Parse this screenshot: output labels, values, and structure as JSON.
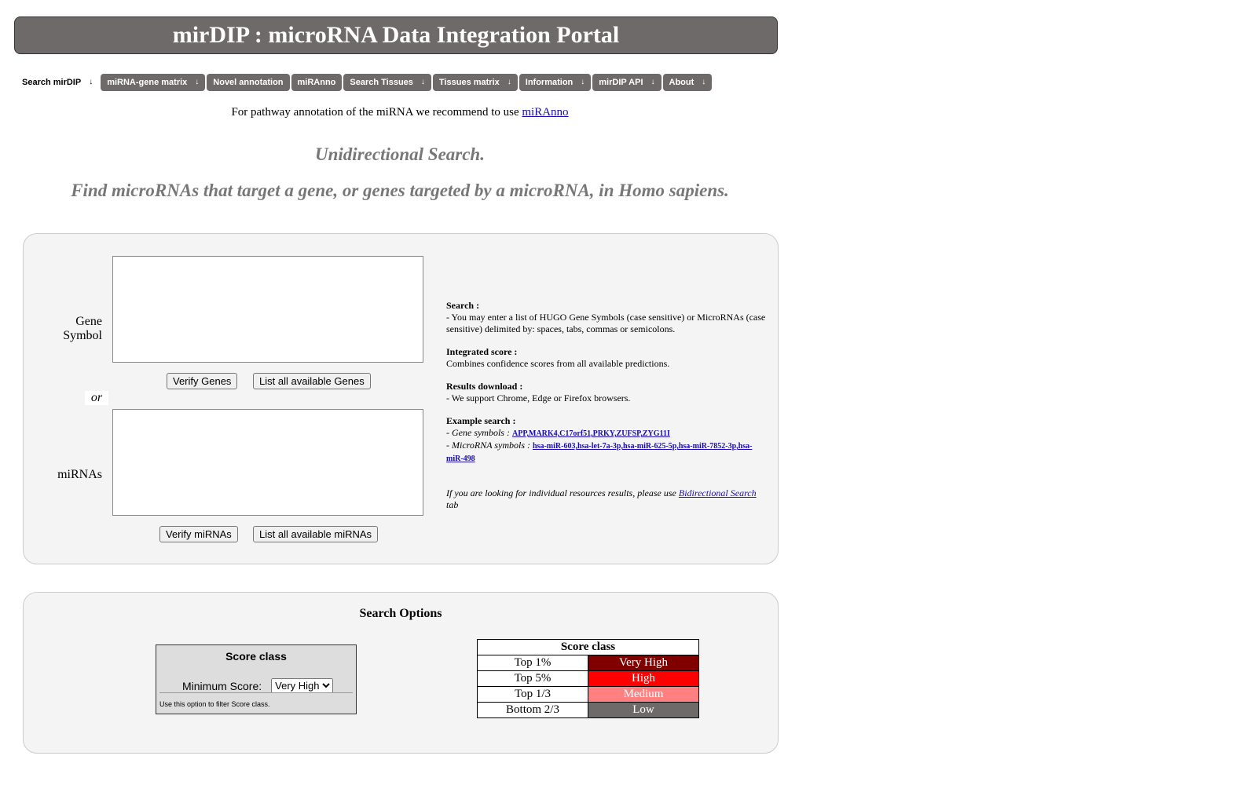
{
  "header": {
    "title": "mirDIP : microRNA Data Integration Portal"
  },
  "nav": {
    "items": [
      {
        "label": "Search mirDIP",
        "arrow": "↓"
      },
      {
        "label": "miRNA-gene matrix",
        "arrow": "↓"
      },
      {
        "label": "Novel annotation",
        "arrow": ""
      },
      {
        "label": "miRAnno",
        "arrow": ""
      },
      {
        "label": "Search Tissues",
        "arrow": "↓"
      },
      {
        "label": "Tissues matrix",
        "arrow": "↓"
      },
      {
        "label": "Information",
        "arrow": "↓"
      },
      {
        "label": "mirDIP API",
        "arrow": "↓"
      },
      {
        "label": "About",
        "arrow": "↓"
      }
    ]
  },
  "recommend": {
    "text": "For pathway annotation of the miRNA we recommend to use",
    "link": "miRAnno"
  },
  "titles": {
    "line1": "Unidirectional Search.",
    "line2": "Find microRNAs that target a gene, or genes targeted by a microRNA, in Homo sapiens."
  },
  "search": {
    "gene_label": "Gene Symbol",
    "mirna_label": "miRNAs",
    "or_label": "or",
    "verify_genes": "Verify Genes",
    "list_genes": "List all available Genes",
    "verify_mirnas": "Verify miRNAs",
    "list_mirnas": "List all available miRNAs",
    "gene_value": "",
    "mirna_value": ""
  },
  "help": {
    "search_title": "Search :",
    "search_text": "- You may enter a list of HUGO Gene Symbols (case sensitive) or MicroRNAs (case sensitive) delimited by: spaces, tabs, commas or semicolons.",
    "integrated_title": "Integrated score :",
    "integrated_text": "Combines confidence scores from all available predictions.",
    "download_title": "Results download :",
    "download_text": "- We support Chrome, Edge or Firefox browsers.",
    "example_title": "Example search :",
    "example_gene_prefix": "- Gene symbols : ",
    "example_gene_link": "APP,MARK4,C17orf51,PRKY,ZUFSP,ZYG11I",
    "example_mirna_prefix": "- MicroRNA symbols : ",
    "example_mirna_link": "hsa-miR-603,hsa-let-7a-3p,hsa-miR-625-5p,hsa-miR-7852-3p,hsa-miR-498",
    "bidir_prefix": "If you are looking for individual resources results, please use ",
    "bidir_link": "Bidirectional Search",
    "bidir_suffix": " tab"
  },
  "options": {
    "title": "Search Options",
    "score_box_title": "Score class",
    "min_score_label": "Minimum Score:",
    "min_score_value": "Very High",
    "min_score_options": [
      "Very High",
      "High",
      "Medium",
      "Low"
    ],
    "note": "Use this option to filter Score class."
  },
  "legend": {
    "title": "Score class",
    "rows": [
      {
        "label": "Top 1%",
        "class": "Very High",
        "color": "#800000"
      },
      {
        "label": "Top 5%",
        "class": "High",
        "color": "#ff0000"
      },
      {
        "label": "Top 1/3",
        "class": "Medium",
        "color": "#ff8080"
      },
      {
        "label": "Bottom 2/3",
        "class": "Low",
        "color": "#6e6a6a"
      }
    ]
  }
}
